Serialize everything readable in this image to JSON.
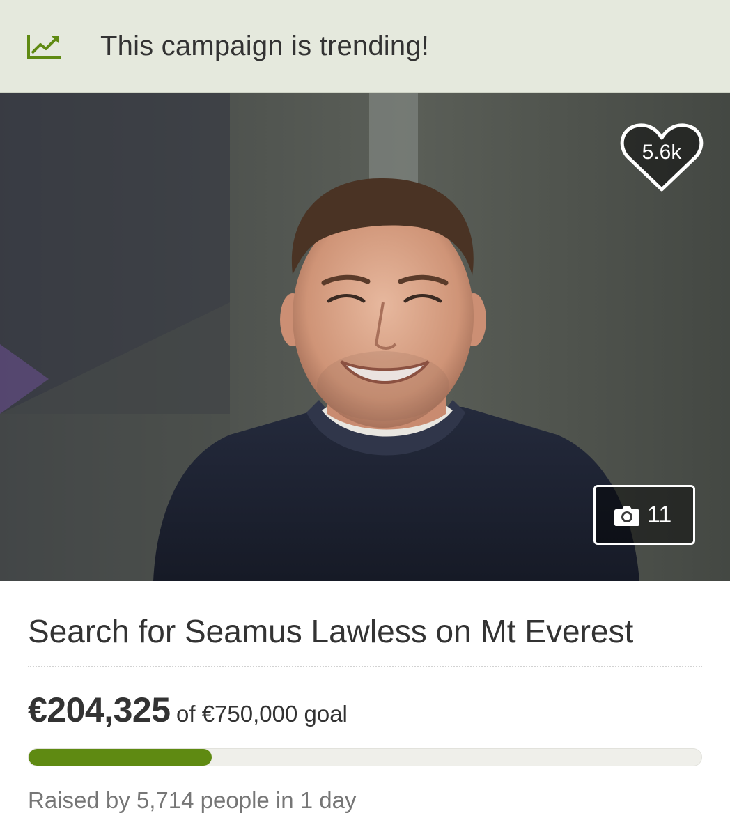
{
  "banner": {
    "icon": "trending-up-icon",
    "text": "This campaign is trending!",
    "accent": "#5f8a12"
  },
  "hero": {
    "image_description": "Portrait photo of a smiling man with short brown hair wearing a navy knit sweater against a dark grey background",
    "hearts_count": "5.6k",
    "photos_count": "11",
    "photos_icon": "camera-icon",
    "hearts_icon": "heart-icon"
  },
  "campaign": {
    "title": "Search for Seamus Lawless on Mt Everest",
    "raised_amount": "€204,325",
    "goal_text": "of €750,000 goal",
    "progress_fraction": 0.2724,
    "raised_by_text": "Raised by 5,714 people in 1 day"
  },
  "colors": {
    "progress": "#5f8a12",
    "banner_bg": "#e5e9dd",
    "text": "#333333",
    "muted_text": "#767676"
  }
}
